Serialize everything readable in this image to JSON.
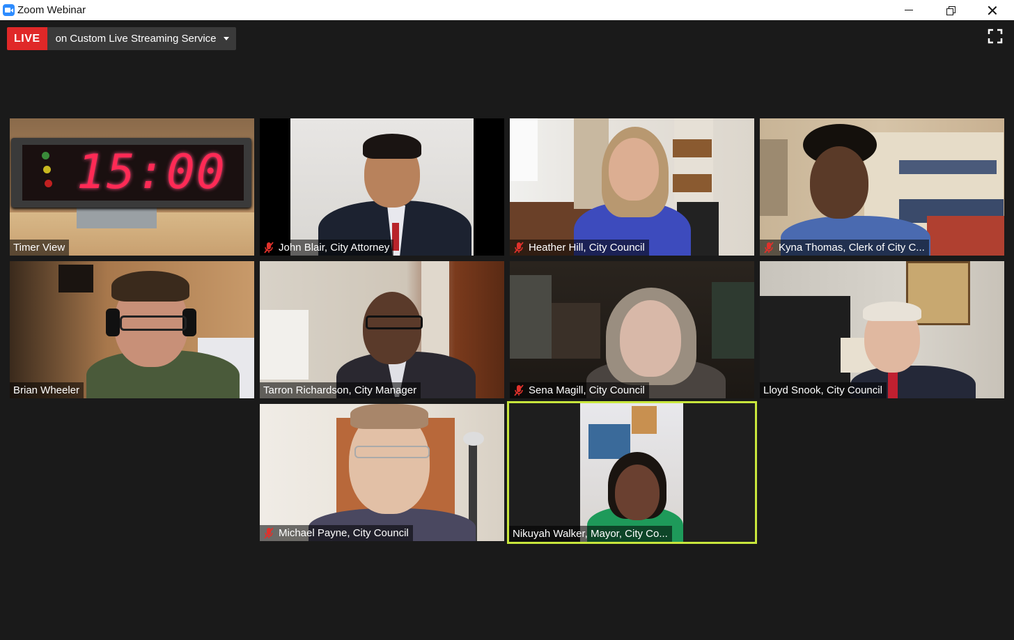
{
  "window": {
    "title": "Zoom Webinar"
  },
  "live": {
    "badge": "LIVE",
    "service": "on Custom Live Streaming Service"
  },
  "tiles": [
    {
      "name": "Timer View",
      "muted": false,
      "timer": "15:00"
    },
    {
      "name": "John Blair, City Attorney",
      "muted": true
    },
    {
      "name": "Heather Hill, City Council",
      "muted": true
    },
    {
      "name": "Kyna Thomas, Clerk of City C...",
      "muted": true
    },
    {
      "name": "Brian Wheeler",
      "muted": false
    },
    {
      "name": "Tarron Richardson, City Manager",
      "muted": false
    },
    {
      "name": "Sena Magill, City Council",
      "muted": true
    },
    {
      "name": "Lloyd Snook, City Council",
      "muted": false
    },
    {
      "name": "Michael Payne, City Council",
      "muted": true
    },
    {
      "name": "Nikuyah Walker, Mayor, City Co...",
      "muted": false,
      "active_speaker": true
    }
  ],
  "colors": {
    "live_red": "#e02828",
    "active_speaker_outline": "#c8e63c",
    "mute_red": "#e0312b",
    "background": "#1a1a1a"
  },
  "icons": {
    "logo": "zoom-logo-icon",
    "fullscreen": "fullscreen-icon",
    "mute": "microphone-muted-icon"
  }
}
